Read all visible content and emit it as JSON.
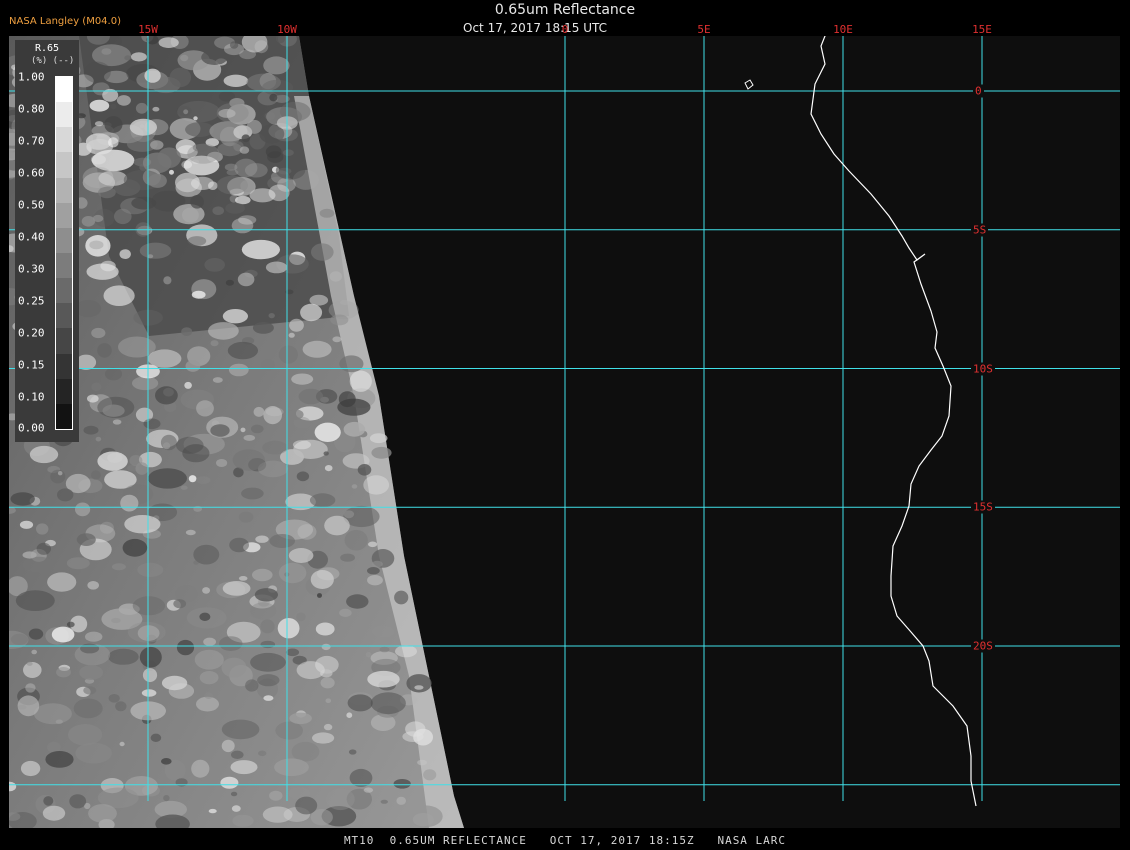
{
  "header": {
    "brand": "NASA Langley (M04.0)",
    "title": "0.65um Reflectance",
    "subtitle": "Oct 17, 2017 18:15 UTC"
  },
  "footer": {
    "caption": "MT10  0.65UM REFLECTANCE   OCT 17, 2017 18:15Z   NASA LARC"
  },
  "map": {
    "longitudes": [
      {
        "label": "15W",
        "value": -15
      },
      {
        "label": "10W",
        "value": -10
      },
      {
        "label": "0",
        "value": 0
      },
      {
        "label": "5E",
        "value": 5
      },
      {
        "label": "10E",
        "value": 10
      },
      {
        "label": "15E",
        "value": 15
      }
    ],
    "latitudes": [
      {
        "label": "0",
        "value": 0
      },
      {
        "label": "5S",
        "value": -5
      },
      {
        "label": "10S",
        "value": -10
      },
      {
        "label": "15S",
        "value": -15
      },
      {
        "label": "20S",
        "value": -20
      }
    ],
    "grid_color": "#40e0e8",
    "label_color": "#e03030",
    "coast_color": "#ffffff"
  },
  "legend": {
    "title": "R.65",
    "unit": "(%)  (--)",
    "ticks": [
      "1.00",
      "0.80",
      "0.70",
      "0.60",
      "0.50",
      "0.40",
      "0.30",
      "0.25",
      "0.20",
      "0.15",
      "0.10",
      "0.00"
    ],
    "ramp": [
      "#ffffff",
      "#ececec",
      "#d8d8d8",
      "#c6c6c6",
      "#b2b2b2",
      "#a0a0a0",
      "#8e8e8e",
      "#7c7c7c",
      "#6a6a6a",
      "#585858",
      "#464646",
      "#343434",
      "#242424",
      "#121212"
    ]
  }
}
